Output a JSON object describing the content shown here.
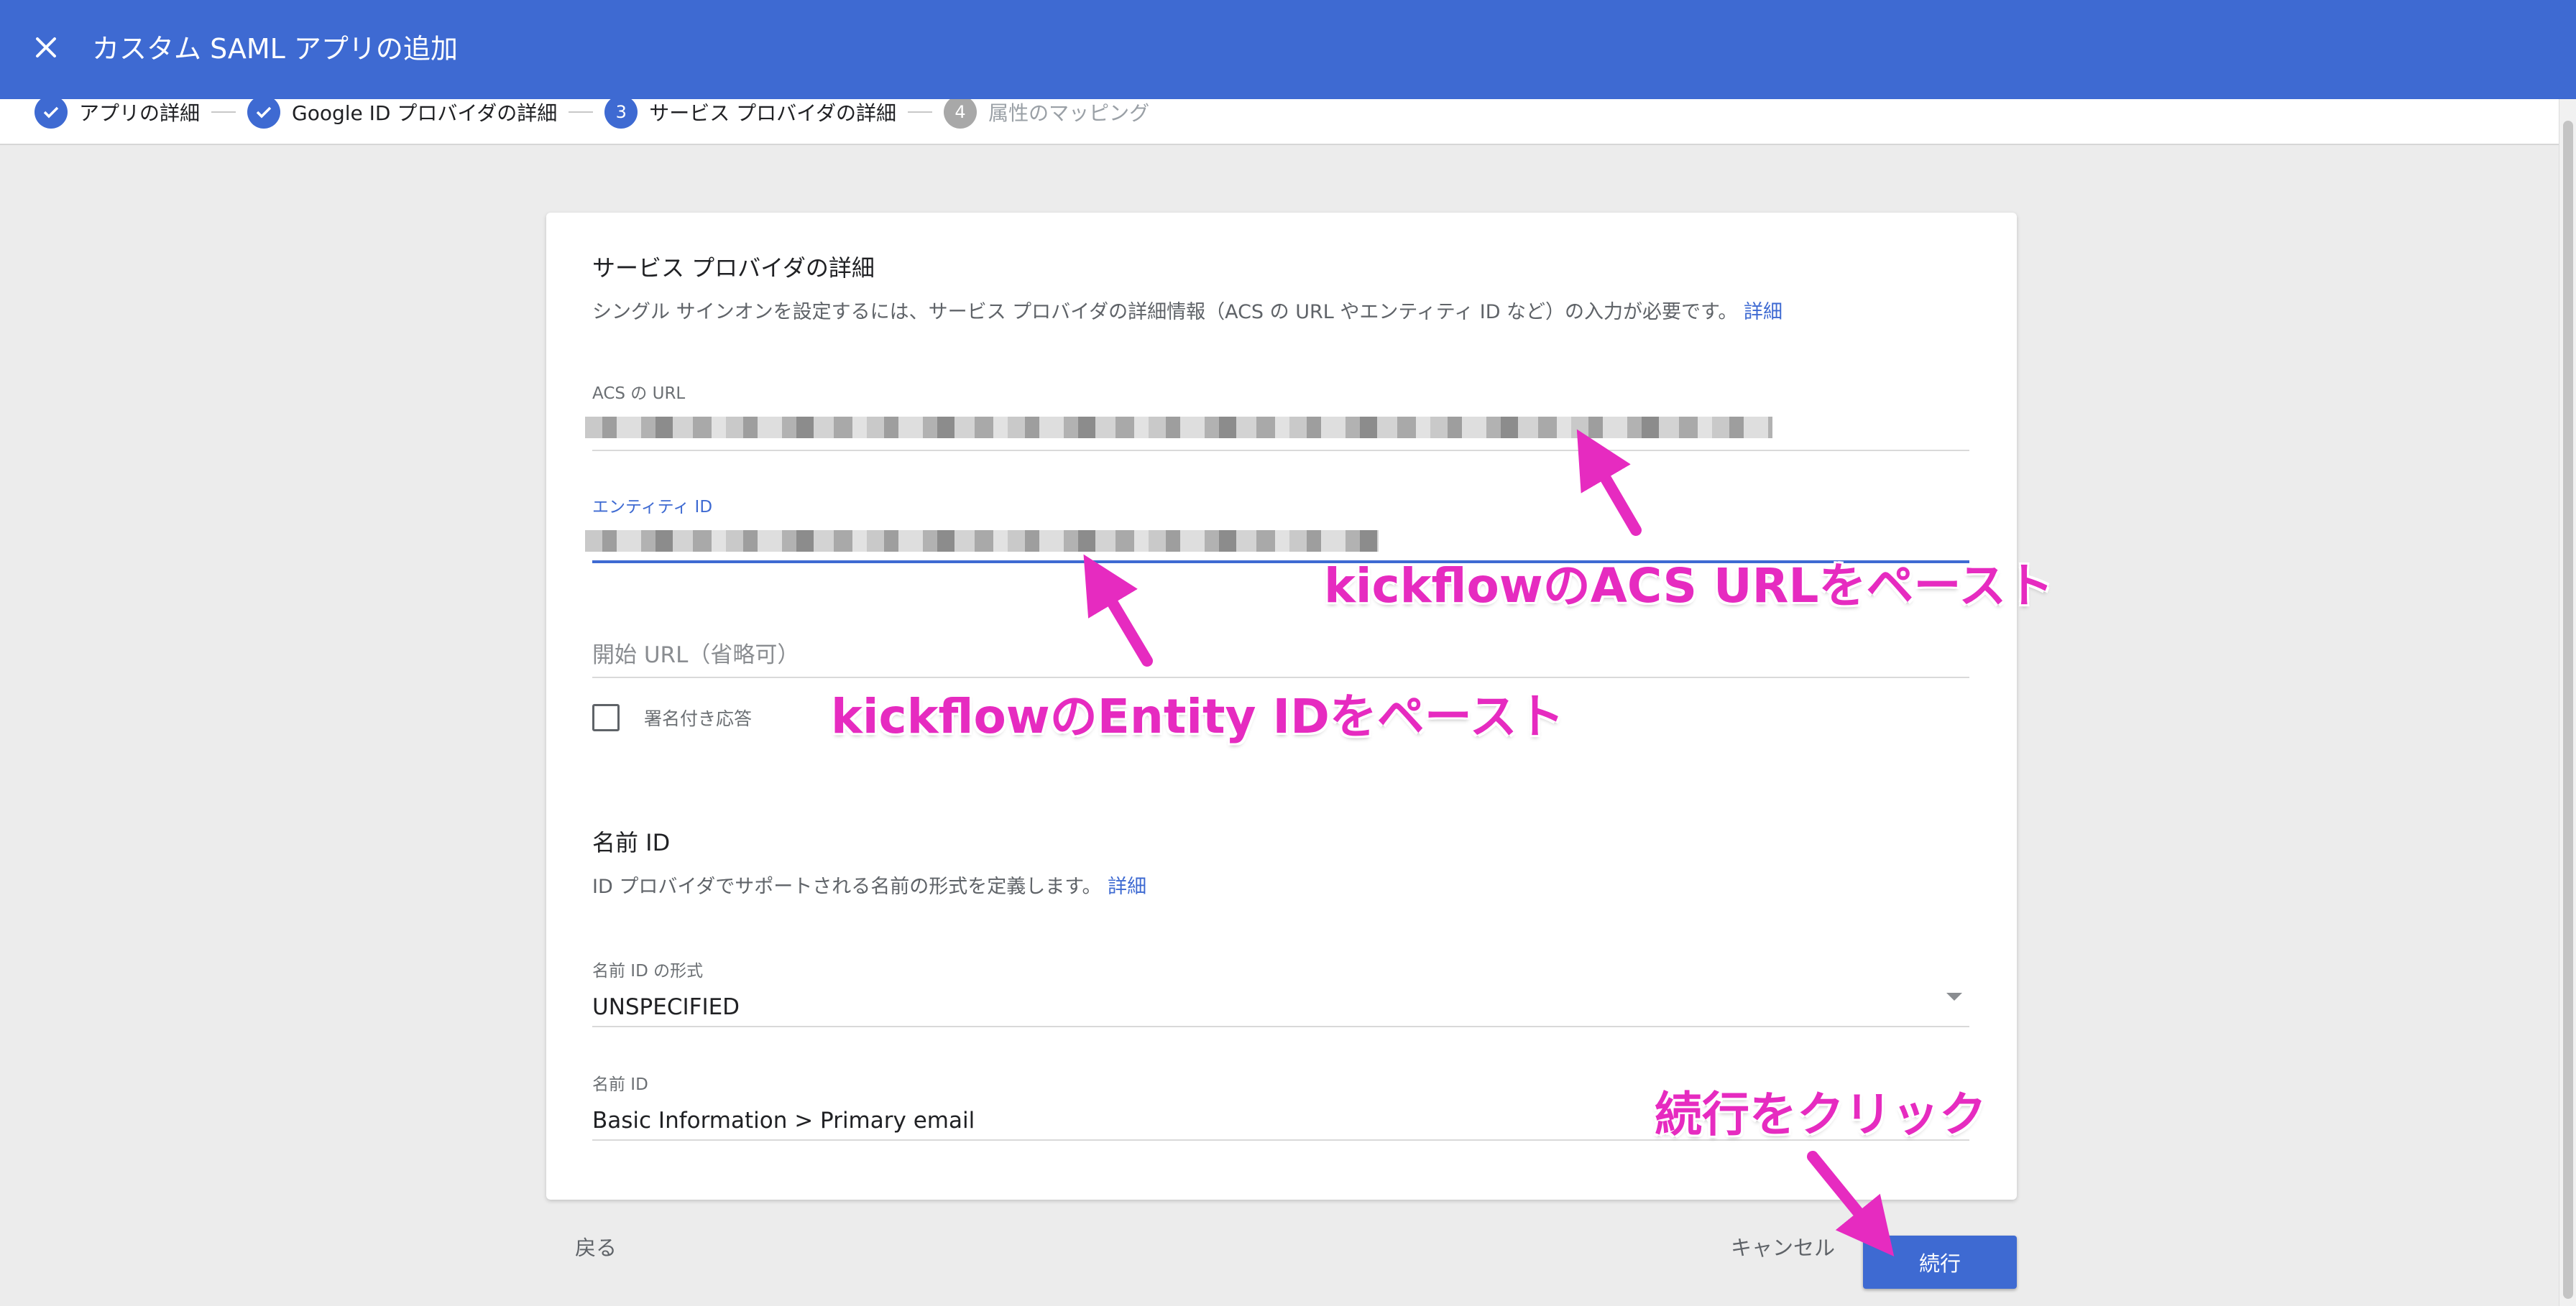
{
  "header": {
    "title": "カスタム SAML アプリの追加",
    "close_icon": "close-icon"
  },
  "stepper": {
    "steps": [
      {
        "label": "アプリの詳細",
        "state": "done"
      },
      {
        "label": "Google ID プロバイダの詳細",
        "state": "done"
      },
      {
        "label": "サービス プロバイダの詳細",
        "state": "active",
        "number": "3"
      },
      {
        "label": "属性のマッピング",
        "state": "pending",
        "number": "4"
      }
    ]
  },
  "service_provider": {
    "title": "サービス プロバイダの詳細",
    "description": "シングル サインオンを設定するには、サービス プロバイダの詳細情報（ACS の URL やエンティティ ID など）の入力が必要です。",
    "details_link": "詳細",
    "acs_url": {
      "label": "ACS の URL"
    },
    "entity_id": {
      "label": "エンティティ ID"
    },
    "start_url": {
      "placeholder": "開始 URL（省略可）"
    },
    "signed_response": {
      "label": "署名付き応答",
      "checked": false
    }
  },
  "name_id": {
    "title": "名前 ID",
    "description": "ID プロバイダでサポートされる名前の形式を定義します。",
    "details_link": "詳細",
    "format": {
      "label": "名前 ID の形式",
      "value": "UNSPECIFIED"
    },
    "value_field": {
      "label": "名前 ID",
      "value": "Basic Information > Primary email"
    }
  },
  "footer": {
    "back_label": "戻る",
    "cancel_label": "キャンセル",
    "continue_label": "続行"
  },
  "annotations": {
    "acs": "kickflowのACS URLをペースト",
    "entity": "kickflowのEntity IDをペースト",
    "continue": "続行をクリック"
  },
  "colors": {
    "accent": "#3e6ad2",
    "annotation": "#e62bc0",
    "background": "#ececec"
  }
}
